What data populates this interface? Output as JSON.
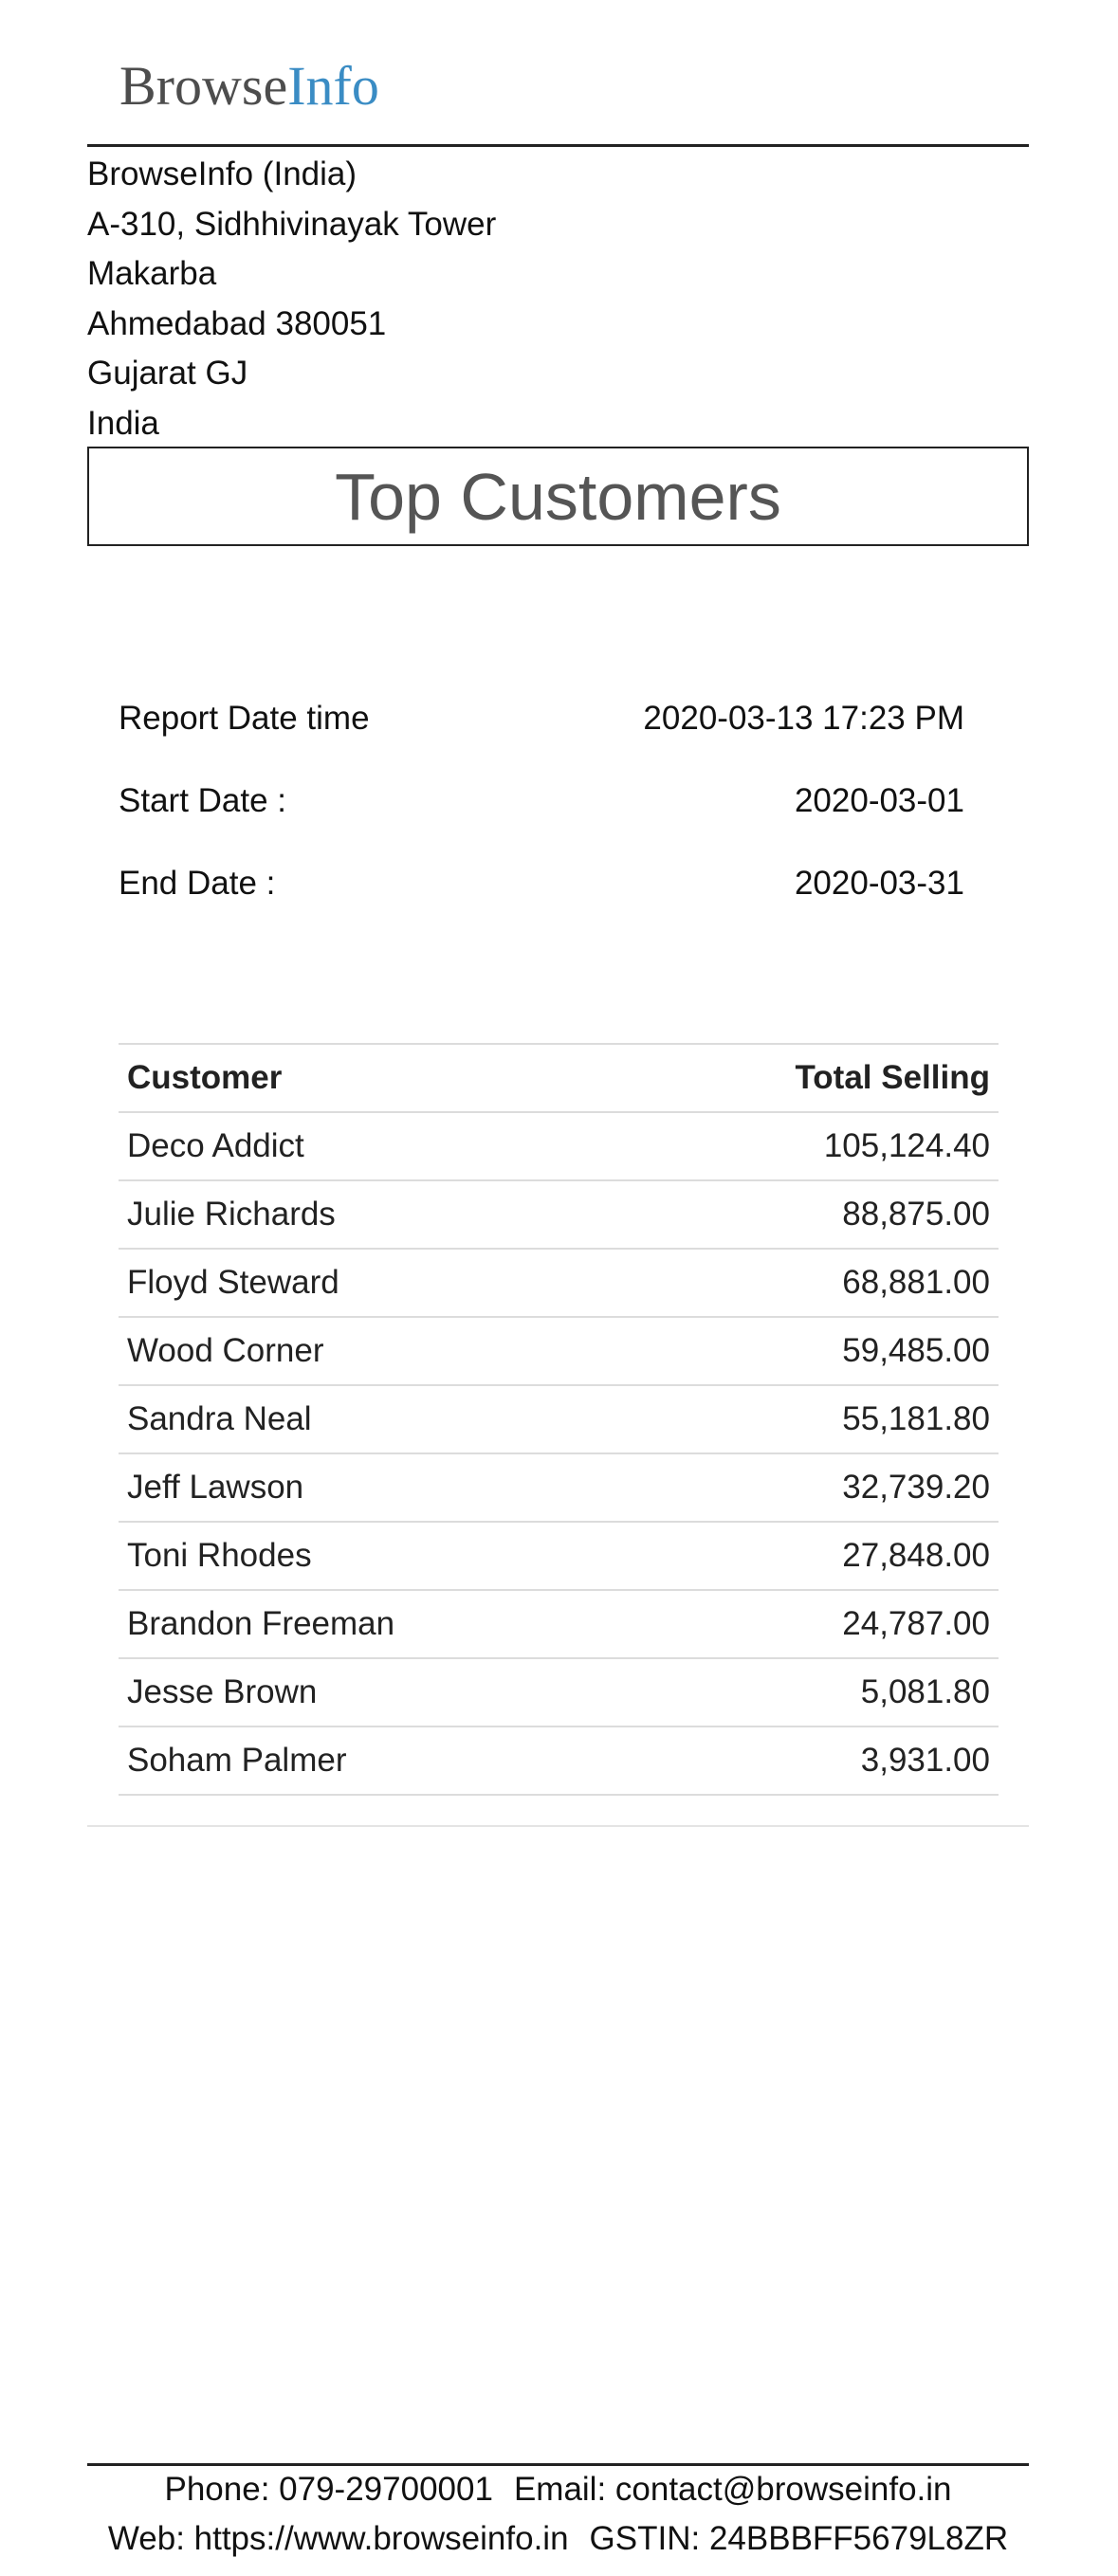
{
  "logo": {
    "part1": "Browse",
    "part2": "Info"
  },
  "company": {
    "address_lines": [
      "BrowseInfo (India)",
      "A-310, Sidhhivinayak Tower",
      "Makarba",
      "Ahmedabad 380051",
      "Gujarat GJ",
      "India"
    ]
  },
  "report": {
    "title": "Top Customers",
    "meta": [
      {
        "label": "Report Date time",
        "value": "2020-03-13 17:23 PM"
      },
      {
        "label": "Start Date :",
        "value": "2020-03-01"
      },
      {
        "label": "End Date :",
        "value": "2020-03-31"
      }
    ]
  },
  "table": {
    "headers": [
      "Customer",
      "Total Selling"
    ],
    "rows": [
      [
        "Deco Addict",
        "105,124.40"
      ],
      [
        "Julie Richards",
        "88,875.00"
      ],
      [
        "Floyd Steward",
        "68,881.00"
      ],
      [
        "Wood Corner",
        "59,485.00"
      ],
      [
        "Sandra Neal",
        "55,181.80"
      ],
      [
        "Jeff Lawson",
        "32,739.20"
      ],
      [
        "Toni Rhodes",
        "27,848.00"
      ],
      [
        "Brandon Freeman",
        "24,787.00"
      ],
      [
        "Jesse Brown",
        "5,081.80"
      ],
      [
        "Soham Palmer",
        "3,931.00"
      ]
    ]
  },
  "footer": {
    "phone": "Phone: 079-29700001",
    "email": "Email: contact@browseinfo.in",
    "web": "Web: https://www.browseinfo.in",
    "gstin": "GSTIN: 24BBBFF5679L8ZR"
  },
  "colors": {
    "logo_primary": "#4d4d4d",
    "logo_accent": "#3a8cc4",
    "title_text": "#555555"
  }
}
